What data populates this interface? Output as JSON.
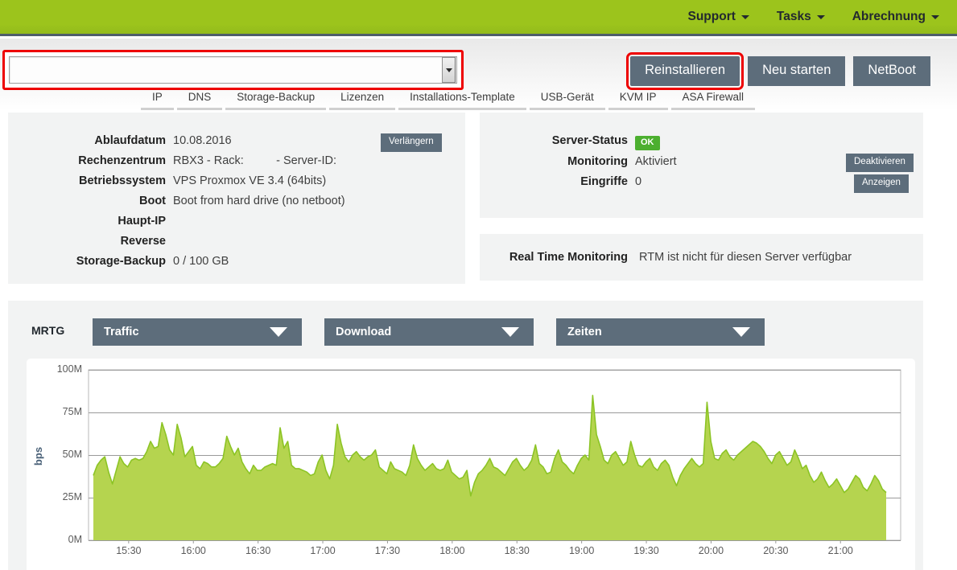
{
  "header": {
    "nav": [
      {
        "label": "Support",
        "has_caret": true
      },
      {
        "label": "Tasks",
        "has_caret": true
      },
      {
        "label": "Abrechnung",
        "has_caret": true
      }
    ],
    "bg_color": "#9cc41c"
  },
  "server_select": {
    "value": "",
    "placeholder": "",
    "highlighted": true,
    "highlight_color": "#ee0000"
  },
  "actions": [
    {
      "label": "Reinstallieren",
      "highlighted": true
    },
    {
      "label": "Neu starten",
      "highlighted": false
    },
    {
      "label": "NetBoot",
      "highlighted": false
    }
  ],
  "tabs": [
    {
      "label": "IP"
    },
    {
      "label": "DNS"
    },
    {
      "label": "Storage-Backup"
    },
    {
      "label": "Lizenzen"
    },
    {
      "label": "Installations-Template"
    },
    {
      "label": "USB-Gerät"
    },
    {
      "label": "KVM IP"
    },
    {
      "label": "ASA Firewall"
    }
  ],
  "server_info": {
    "rows": [
      {
        "key": "Ablaufdatum",
        "value": "10.08.2016"
      },
      {
        "key": "Rechenzentrum",
        "value": "RBX3 - Rack:          - Server-ID:"
      },
      {
        "key": "Betriebssystem",
        "value": "VPS Proxmox VE 3.4 (64bits)"
      },
      {
        "key": "Boot",
        "value": "Boot from hard drive (no netboot)"
      },
      {
        "key": "Haupt-IP",
        "value": ""
      },
      {
        "key": "Reverse",
        "value": ""
      },
      {
        "key": "Storage-Backup",
        "value": "0 / 100 GB"
      }
    ],
    "extend_button": "Verlängern"
  },
  "status_panel": {
    "rows": [
      {
        "key": "Server-Status",
        "value": "OK",
        "is_badge": true,
        "badge_color": "#4caf2f"
      },
      {
        "key": "Monitoring",
        "value": "Aktiviert",
        "is_badge": false
      },
      {
        "key": "Eingriffe",
        "value": "0",
        "is_badge": false
      }
    ],
    "deactivate_button": "Deaktivieren",
    "show_button": "Anzeigen"
  },
  "rtm_panel": {
    "label": "Real Time Monitoring",
    "value": "RTM ist nicht für diesen Server verfügbar"
  },
  "mrtg": {
    "label": "MRTG",
    "dropdowns": [
      {
        "selected": "Traffic"
      },
      {
        "selected": "Download"
      },
      {
        "selected": "Zeiten"
      }
    ]
  },
  "chart_data": {
    "type": "area",
    "title": "",
    "xlabel": "",
    "ylabel": "bps",
    "ylim": [
      0,
      100
    ],
    "yticks": [
      0,
      25,
      50,
      75,
      100
    ],
    "ytick_labels": [
      "0M",
      "25M",
      "50M",
      "75M",
      "100M"
    ],
    "xticks": [
      "15:30",
      "16:00",
      "16:30",
      "17:00",
      "17:30",
      "18:00",
      "18:30",
      "19:00",
      "19:30",
      "20:00",
      "20:30",
      "21:00"
    ],
    "x_start": "15:18",
    "x_end": "21:10",
    "grid": true,
    "legend": "none",
    "unit": "M",
    "series": [
      {
        "name": "Traffic Download",
        "line_color": "#8cc425",
        "fill_color": "#b5d44f",
        "values": [
          38,
          44,
          47,
          49,
          40,
          33,
          41,
          49,
          45,
          43,
          47,
          48,
          47,
          48,
          52,
          58,
          54,
          55,
          69,
          62,
          53,
          50,
          68,
          60,
          49,
          52,
          55,
          44,
          42,
          46,
          45,
          43,
          43,
          45,
          48,
          61,
          55,
          50,
          54,
          46,
          42,
          39,
          44,
          41,
          41,
          43,
          44,
          45,
          44,
          66,
          54,
          58,
          44,
          42,
          42,
          41,
          40,
          38,
          39,
          46,
          50,
          41,
          36,
          44,
          68,
          57,
          49,
          46,
          50,
          52,
          49,
          47,
          49,
          50,
          53,
          43,
          41,
          39,
          46,
          42,
          41,
          40,
          38,
          44,
          56,
          48,
          44,
          41,
          43,
          45,
          42,
          41,
          42,
          47,
          40,
          38,
          36,
          37,
          41,
          26,
          34,
          39,
          41,
          44,
          48,
          43,
          42,
          40,
          38,
          42,
          46,
          48,
          44,
          41,
          43,
          47,
          56,
          45,
          43,
          39,
          40,
          48,
          53,
          46,
          44,
          41,
          39,
          44,
          48,
          50,
          47,
          85,
          62,
          55,
          47,
          45,
          50,
          52,
          48,
          44,
          46,
          58,
          50,
          44,
          43,
          46,
          48,
          43,
          41,
          45,
          47,
          44,
          37,
          32,
          38,
          42,
          45,
          48,
          45,
          43,
          45,
          81,
          58,
          48,
          47,
          51,
          53,
          49,
          47,
          50,
          52,
          54,
          56,
          58,
          57,
          55,
          52,
          48,
          45,
          50,
          52,
          48,
          44,
          46,
          53,
          48,
          42,
          44,
          38,
          34,
          36,
          40,
          35,
          31,
          33,
          36,
          32,
          28,
          30,
          34,
          38,
          36,
          31,
          29,
          33,
          38,
          35,
          30,
          28
        ]
      }
    ]
  }
}
